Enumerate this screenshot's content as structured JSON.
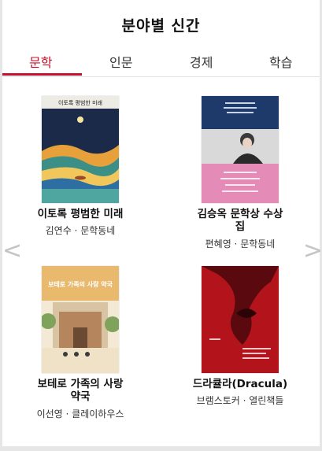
{
  "section": {
    "title": "분야별 신간"
  },
  "tabs": [
    {
      "label": "문학",
      "active": true
    },
    {
      "label": "인문",
      "active": false
    },
    {
      "label": "경제",
      "active": false
    },
    {
      "label": "학습",
      "active": false
    }
  ],
  "nav": {
    "prev_glyph": "<",
    "next_glyph": ">"
  },
  "books": [
    {
      "title": "이토록 평범한 미래",
      "author": "김연수 · 문학동네",
      "cover_text": "이토록 평범한 미래"
    },
    {
      "title_line1": "김승옥 문학상 수상",
      "title_line2": "집",
      "author": "편혜영 · 문학동네"
    },
    {
      "title_line1": "보테로 가족의 사랑",
      "title_line2": "약국",
      "author": "이선영 · 클레이하우스",
      "cover_text": "보테로 가족의 사랑 약국"
    },
    {
      "title": "드라큘라(Dracula)",
      "author": "브램스토커 · 열린책들"
    }
  ],
  "colors": {
    "accent": "#c8102e",
    "arrow": "#c4c4c4"
  }
}
